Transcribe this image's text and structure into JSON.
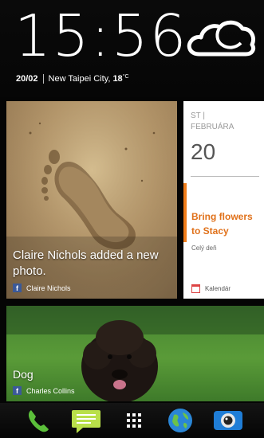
{
  "clock": {
    "time": "15:56",
    "date": "20/02",
    "location": "New Taipei City,",
    "temperature": "18",
    "temperature_unit": "°C",
    "weather_icon": "cloud-icon"
  },
  "feed_cards": [
    {
      "caption": "Claire Nichols added a new photo.",
      "source_icon": "facebook-icon",
      "author": "Claire Nichols"
    },
    {
      "caption": "Dog",
      "source_icon": "facebook-icon",
      "author": "Charles Collins"
    }
  ],
  "calendar_card": {
    "day_of_week": "ST |",
    "month": "FEBRUÁRA",
    "day": "20",
    "event_title": "Bring flowers to Stacy",
    "event_time": "Celý deň",
    "app_label": "Kalendár",
    "accent_color": "#f07c1a"
  },
  "dock": {
    "items": [
      {
        "icon": "phone-icon"
      },
      {
        "icon": "messages-icon"
      },
      {
        "icon": "apps-grid-icon"
      },
      {
        "icon": "browser-globe-icon"
      },
      {
        "icon": "camera-icon"
      }
    ]
  }
}
